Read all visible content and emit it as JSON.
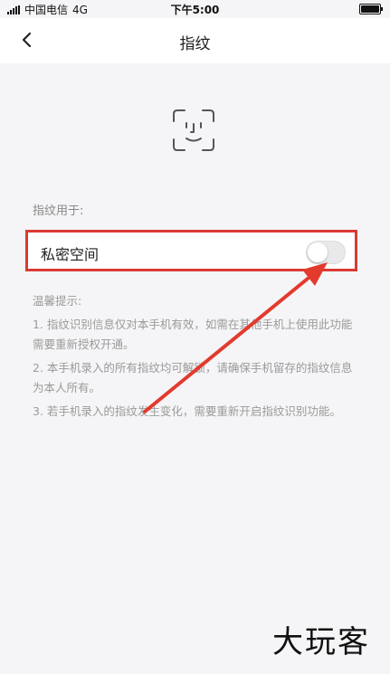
{
  "statusbar": {
    "carrier": "中国电信",
    "network": "4G",
    "time": "下午5:00"
  },
  "nav": {
    "title": "指纹"
  },
  "section": {
    "label": "指纹用于:"
  },
  "private_space": {
    "label": "私密空间",
    "toggle_on": false
  },
  "tips": {
    "title": "温馨提示:",
    "items": [
      "1. 指纹识别信息仅对本手机有效，如需在其他手机上使用此功能需要重新授权开通。",
      "2. 本手机录入的所有指纹均可解锁，请确保手机留存的指纹信息为本人所有。",
      "3. 若手机录入的指纹发生变化，需要重新开启指纹识别功能。"
    ]
  },
  "watermark": "大玩客",
  "colors": {
    "highlight": "#d93a33",
    "arrow": "#e23b2e"
  },
  "icons": {
    "back": "chevron-left-icon",
    "face": "face-scan-icon"
  }
}
